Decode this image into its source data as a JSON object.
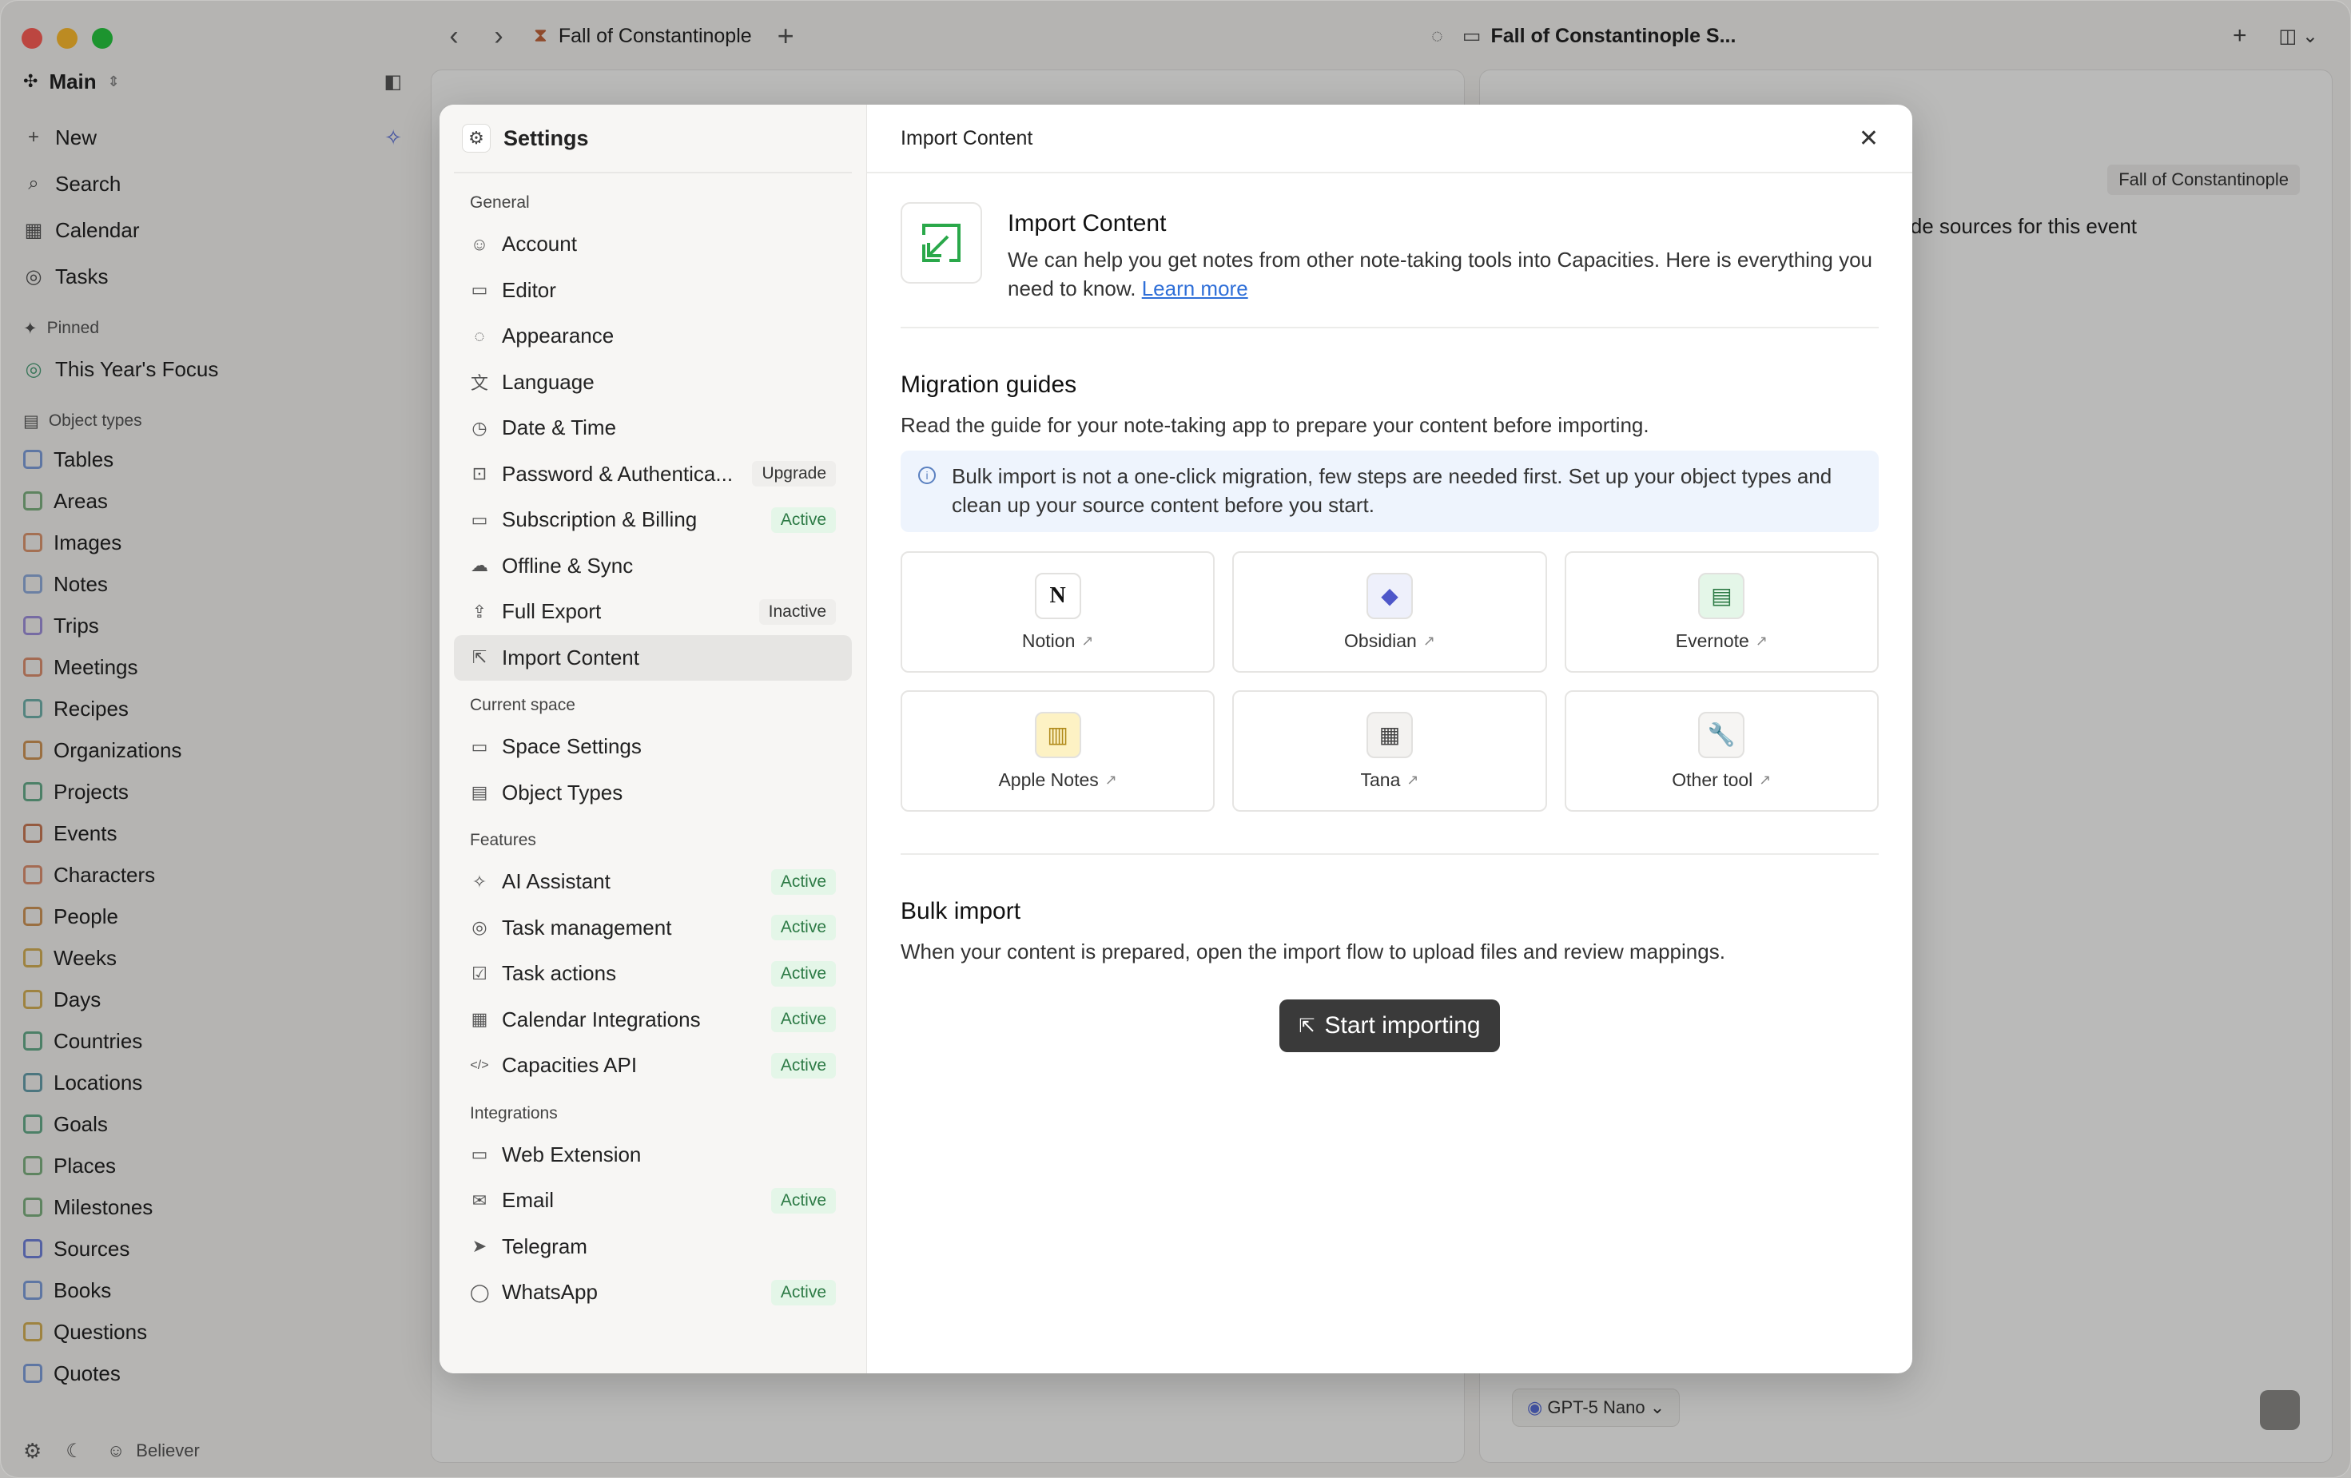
{
  "window": {
    "tab_title": "Fall of Constantinople",
    "chat_title": "Fall of Constantinople S..."
  },
  "sidebar": {
    "space_name": "Main",
    "actions": [
      {
        "label": "New",
        "icon": "plus-icon"
      },
      {
        "label": "Search",
        "icon": "search-icon"
      },
      {
        "label": "Calendar",
        "icon": "calendar-icon"
      },
      {
        "label": "Tasks",
        "icon": "task-icon"
      }
    ],
    "pinned_label": "Pinned",
    "pinned": [
      {
        "label": "This Year's Focus"
      }
    ],
    "object_types_label": "Object types",
    "object_types": [
      {
        "label": "Tables",
        "color": "#6a8fd8"
      },
      {
        "label": "Areas",
        "color": "#6aa76f"
      },
      {
        "label": "Images",
        "color": "#d8865a"
      },
      {
        "label": "Notes",
        "color": "#7fa0d8"
      },
      {
        "label": "Trips",
        "color": "#8f7fd8"
      },
      {
        "label": "Meetings",
        "color": "#d87f5a"
      },
      {
        "label": "Recipes",
        "color": "#5aa7a0"
      },
      {
        "label": "Organizations",
        "color": "#c9853d"
      },
      {
        "label": "Projects",
        "color": "#4ea07a"
      },
      {
        "label": "Events",
        "color": "#c2643a"
      },
      {
        "label": "Characters",
        "color": "#d87f5a"
      },
      {
        "label": "People",
        "color": "#c9853d"
      },
      {
        "label": "Weeks",
        "color": "#d0a43c"
      },
      {
        "label": "Days",
        "color": "#d0a43c"
      },
      {
        "label": "Countries",
        "color": "#4ea07a"
      },
      {
        "label": "Locations",
        "color": "#4e8fa0"
      },
      {
        "label": "Goals",
        "color": "#4ea07a"
      },
      {
        "label": "Places",
        "color": "#6aa76f"
      },
      {
        "label": "Milestones",
        "color": "#6aa76f"
      },
      {
        "label": "Sources",
        "color": "#5a6fd8"
      },
      {
        "label": "Books",
        "color": "#6a8fd8"
      },
      {
        "label": "Questions",
        "color": "#d0a43c"
      },
      {
        "label": "Quotes",
        "color": "#6a8fd8"
      }
    ],
    "bottom_user": "Believer"
  },
  "right_pane": {
    "tag": "Fall of Constantinople",
    "text_fragment": "vide sources for this event",
    "model": "GPT-5 Nano"
  },
  "settings": {
    "title": "Settings",
    "sections": [
      {
        "title": "General",
        "items": [
          {
            "label": "Account",
            "icon": "user-icon",
            "badge": ""
          },
          {
            "label": "Editor",
            "icon": "keyboard-icon",
            "badge": ""
          },
          {
            "label": "Appearance",
            "icon": "palette-icon",
            "badge": ""
          },
          {
            "label": "Language",
            "icon": "translate-icon",
            "badge": ""
          },
          {
            "label": "Date & Time",
            "icon": "clock-icon",
            "badge": ""
          },
          {
            "label": "Password & Authentica...",
            "icon": "lock-icon",
            "badge": "Upgrade"
          },
          {
            "label": "Subscription & Billing",
            "icon": "credit-card-icon",
            "badge": "Active"
          },
          {
            "label": "Offline & Sync",
            "icon": "cloud-icon",
            "badge": ""
          },
          {
            "label": "Full Export",
            "icon": "export-icon",
            "badge": "Inactive"
          },
          {
            "label": "Import Content",
            "icon": "import-icon",
            "badge": ""
          }
        ]
      },
      {
        "title": "Current space",
        "items": [
          {
            "label": "Space Settings",
            "icon": "monitor-icon",
            "badge": ""
          },
          {
            "label": "Object Types",
            "icon": "table-icon",
            "badge": ""
          }
        ]
      },
      {
        "title": "Features",
        "items": [
          {
            "label": "AI Assistant",
            "icon": "sparkle-icon",
            "badge": "Active"
          },
          {
            "label": "Task management",
            "icon": "check-circle-icon",
            "badge": "Active"
          },
          {
            "label": "Task actions",
            "icon": "checkbox-icon",
            "badge": "Active"
          },
          {
            "label": "Calendar Integrations",
            "icon": "calendar-icon",
            "badge": "Active"
          },
          {
            "label": "Capacities API",
            "icon": "code-icon",
            "badge": "Active"
          }
        ]
      },
      {
        "title": "Integrations",
        "items": [
          {
            "label": "Web Extension",
            "icon": "browser-icon",
            "badge": ""
          },
          {
            "label": "Email",
            "icon": "mail-icon",
            "badge": "Active"
          },
          {
            "label": "Telegram",
            "icon": "send-icon",
            "badge": ""
          },
          {
            "label": "WhatsApp",
            "icon": "whatsapp-icon",
            "badge": "Active"
          }
        ]
      }
    ],
    "active_item": "Import Content"
  },
  "import": {
    "header": "Import Content",
    "intro_title": "Import Content",
    "intro_text": "We can help you get notes from other note-taking tools into Capacities. Here is everything you need to know.",
    "learn_more": "Learn more",
    "migration_title": "Migration guides",
    "migration_desc": "Read the guide for your note-taking app to prepare your content before importing.",
    "note": "Bulk import is not a one-click migration, few steps are needed first. Set up your object types and clean up your source content before you start.",
    "tools": [
      {
        "label": "Notion",
        "icon": "notion-icon",
        "glyph": "N",
        "bg": "#ffffff",
        "fg": "#111111"
      },
      {
        "label": "Obsidian",
        "icon": "obsidian-icon",
        "glyph": "◆",
        "bg": "#eef0fb",
        "fg": "#4e57c9"
      },
      {
        "label": "Evernote",
        "icon": "evernote-icon",
        "glyph": "▤",
        "bg": "#e4f6e8",
        "fg": "#2c7a45"
      },
      {
        "label": "Apple Notes",
        "icon": "apple-notes-icon",
        "glyph": "▥",
        "bg": "#fdf2c4",
        "fg": "#b08a1a"
      },
      {
        "label": "Tana",
        "icon": "tana-icon",
        "glyph": "▦",
        "bg": "#f3f2f0",
        "fg": "#444444"
      },
      {
        "label": "Other tool",
        "icon": "wrench-icon",
        "glyph": "🔧",
        "bg": "#f6f5f3",
        "fg": "#666666"
      }
    ],
    "bulk_title": "Bulk import",
    "bulk_desc": "When your content is prepared, open the import flow to upload files and review mappings.",
    "start_button": "Start importing"
  }
}
